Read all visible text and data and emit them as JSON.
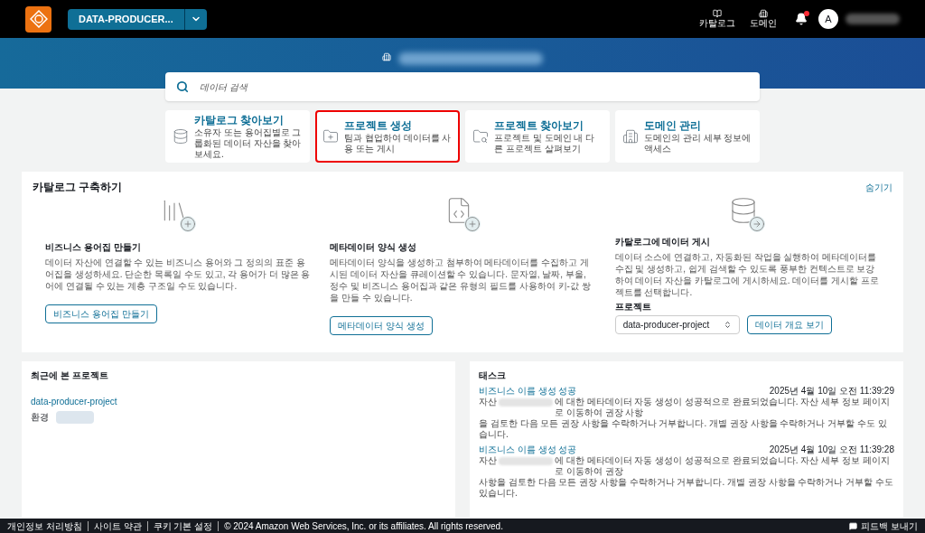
{
  "top_bar": {
    "project_button": "DATA-PRODUCER...",
    "nav": [
      {
        "label": "카탈로그",
        "kind": "book"
      },
      {
        "label": "도메인",
        "kind": "building"
      }
    ],
    "notifications_unread": true,
    "avatar": "A"
  },
  "search": {
    "placeholder": "데이터 검색"
  },
  "quick_cards": [
    {
      "title": "카탈로그 찾아보기",
      "description": "소유자 또는 용어집별로 그룹화된 데이터 자산을 찾아보세요.",
      "kind": "catalog",
      "selected": false
    },
    {
      "title": "프로젝트 생성",
      "description": "팀과 협업하여 데이터를 사용 또는 게시",
      "kind": "create",
      "selected": true
    },
    {
      "title": "프로젝트 찾아보기",
      "description": "프로젝트 및 도메인 내 다른 프로젝트 살펴보기",
      "kind": "browse",
      "selected": false
    },
    {
      "title": "도메인 관리",
      "description": "도메인의 관리 세부 정보에 액세스",
      "kind": "domain",
      "selected": false
    }
  ],
  "catalog_panel": {
    "title": "카탈로그 구축하기",
    "hide_link": "숨기기",
    "columns": [
      {
        "kind": "glossary",
        "heading": "비즈니스 용어집 만들기",
        "text": "데이터 자산에 연결할 수 있는 비즈니스 용어와 그 정의의 표준 용어집을 생성하세요. 단순한 목록일 수도 있고, 각 용어가 더 많은 용어에 연결될 수 있는 계층 구조일 수도 있습니다.",
        "button": "비즈니스 용어집 만들기"
      },
      {
        "kind": "metadata",
        "heading": "메타데이터 양식 생성",
        "text": "메타데이터 양식을 생성하고 첨부하여 메타데이터를 수집하고 게시된 데이터 자산을 큐레이션할 수 있습니다. 문자열, 날짜, 부울, 정수 및 비즈니스 용어집과 같은 유형의 필드를 사용하여 키-값 쌍을 만들 수 있습니다.",
        "button": "메타데이터 양식 생성"
      },
      {
        "kind": "publish",
        "heading": "카탈로그에 데이터 게시",
        "text": "데이터 소스에 연결하고, 자동화된 작업을 실행하여 메타데이터를 수집 및 생성하고, 쉽게 검색할 수 있도록 풍부한 컨텍스트로 보강하여 데이터 자산을 카탈로그에 게시하세요. 데이터를 게시할 프로젝트를 선택합니다.",
        "select_label": "프로젝트",
        "select_value": "data-producer-project",
        "button": "데이터 개요 보기"
      }
    ]
  },
  "recent_projects": {
    "title": "최근에 본 프로젝트",
    "items": [
      {
        "name": "data-producer-project",
        "env_label": "환경"
      }
    ]
  },
  "tasks": {
    "title": "태스크",
    "items": [
      {
        "title": "비즈니스 이름 생성 성공",
        "time": "2025년 4월 10일 오전 11:39:29",
        "prefix": "자산",
        "line1": "에 대한 메타데이터 자동 생성이 성공적으로 완료되었습니다. 자산 세부 정보 페이지로 이동하여 권장 사항",
        "line2": "을 검토한 다음 모든 권장 사항을 수락하거나 거부합니다. 개별 권장 사항을 수락하거나 거부할 수도 있습니다."
      },
      {
        "title": "비즈니스 이름 생성 성공",
        "time": "2025년 4월 10일 오전 11:39:28",
        "prefix": "자산",
        "line1": "에 대한 메타데이터 자동 생성이 성공적으로 완료되었습니다. 자산 세부 정보 페이지로 이동하여 권장",
        "line2": "사항을 검토한 다음 모든 권장 사항을 수락하거나 거부합니다. 개별 권장 사항을 수락하거나 거부할 수도 있습니다."
      }
    ]
  },
  "footer": {
    "links": [
      "개인정보 처리방침",
      "사이트 약관",
      "쿠키 기본 설정"
    ],
    "copyright": "© 2024 Amazon Web Services, Inc. or its affiliates. All rights reserved.",
    "feedback": "피드백 보내기"
  }
}
